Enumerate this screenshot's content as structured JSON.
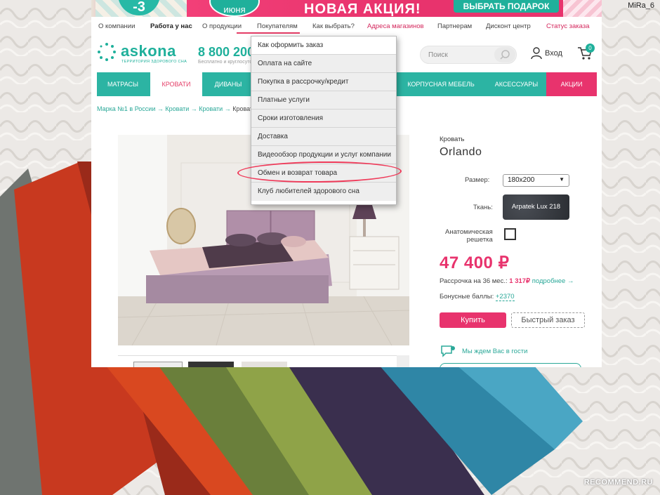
{
  "banner": {
    "badge": "-3",
    "date": "июня",
    "title": "НОВАЯ АКЦИЯ!",
    "gift_button": "ВЫБРАТЬ ПОДАРОК"
  },
  "topnav": [
    {
      "label": "О компании"
    },
    {
      "label": "Работа у нас"
    },
    {
      "label": "О продукции"
    },
    {
      "label": "Покупателям"
    },
    {
      "label": "Как выбрать?"
    },
    {
      "label": "Адреса магазинов"
    },
    {
      "label": "Партнерам"
    },
    {
      "label": "Дисконт центр"
    },
    {
      "label": "Статус заказа"
    }
  ],
  "header": {
    "logo": "askona",
    "logo_sub": "ТЕРРИТОРИЯ ЗДОРОВОГО СНА",
    "phone": "8 800 200",
    "phone_sub": "Бесплатно и круглосуточно",
    "search_placeholder": "Поиск",
    "login": "Вход",
    "cart_count": "0"
  },
  "categories": [
    {
      "label": "МАТРАСЫ"
    },
    {
      "label": "КРОВАТИ"
    },
    {
      "label": "ДИВАНЫ"
    },
    {
      "label": "КОРПУСНАЯ МЕБЕЛЬ"
    },
    {
      "label": "АКСЕССУАРЫ"
    },
    {
      "label": "АКЦИИ"
    }
  ],
  "breadcrumb": {
    "items": [
      "Марка №1 в России",
      "Кровати",
      "Кровати"
    ],
    "current": "Кроват"
  },
  "dropdown": [
    {
      "label": "Как оформить заказ"
    },
    {
      "label": "Оплата на сайте"
    },
    {
      "label": "Покупка в рассрочку/кредит"
    },
    {
      "label": "Платные услуги"
    },
    {
      "label": "Сроки изготовления"
    },
    {
      "label": "Доставка"
    },
    {
      "label": "Видеообзор продукции и услуг компании"
    },
    {
      "label": "Обмен и возврат товара"
    },
    {
      "label": "Клуб любителей здорового сна"
    }
  ],
  "product": {
    "category": "Кровать",
    "name": "Orlando",
    "size_label": "Размер:",
    "size_value": "180x200",
    "fabric_label": "Ткань:",
    "fabric_value": "Arpatek Lux 218",
    "anatomic_label_1": "Анатомическая",
    "anatomic_label_2": "решетка",
    "price": "47 400 ₽",
    "installment_text": "Рассрочка на 36 мес.: ",
    "installment_value": "1 317₽",
    "installment_link": "подробнее →",
    "bonus_text": "Бонусные баллы: ",
    "bonus_value": "+2370",
    "buy_button": "Купить",
    "quick_order_button": "Быстрый заказ",
    "visit_text": "Мы ждем Вас в гости"
  },
  "watermark": {
    "user": "MiRa_6",
    "site": "RECOMMEND.RU"
  },
  "colors": {
    "teal": "#2cb4a3",
    "pink": "#e8336d",
    "highlight_circle": "#ef3b5a"
  }
}
